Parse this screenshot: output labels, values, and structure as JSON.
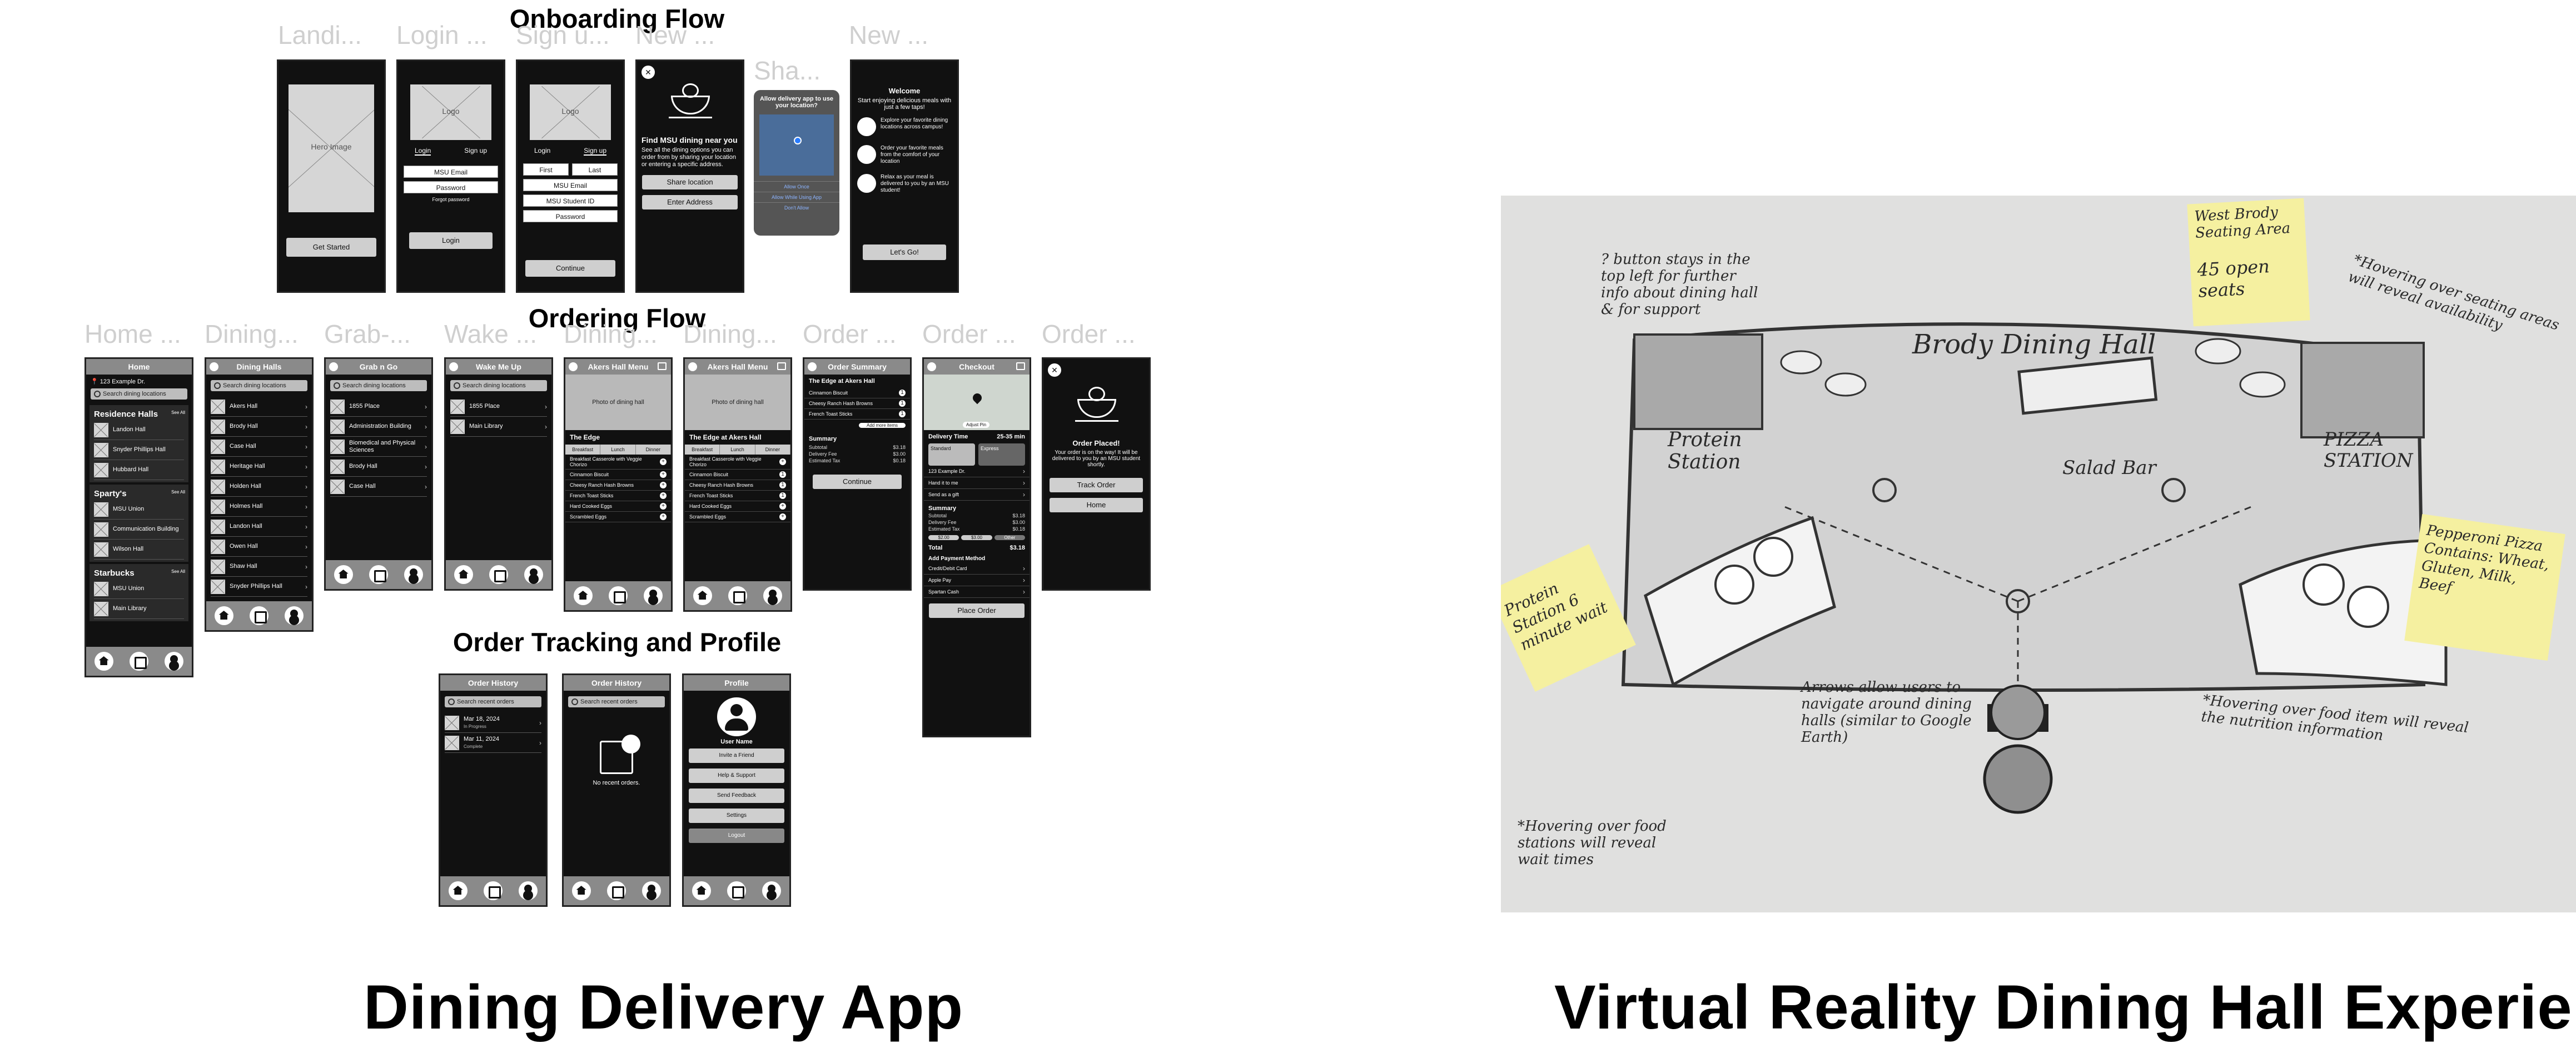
{
  "titles": {
    "left": "Dining Delivery App",
    "right": "Virtual Reality Dining Hall Experience"
  },
  "flows": {
    "onboarding": "Onboarding Flow",
    "ordering": "Ordering Flow",
    "tracking": "Order Tracking and Profile"
  },
  "onboarding_screens": [
    "Landi...",
    "Login ...",
    "Sign u...",
    "New ...",
    "Sha...",
    "New ..."
  ],
  "ordering_screens": [
    "Home ...",
    "Dining...",
    "Grab-...",
    "Wake ...",
    "Dining...",
    "Dining...",
    "Order ...",
    "Order ...",
    "Order ..."
  ],
  "landing": {
    "hero": "Hero Image",
    "button": "Get Started"
  },
  "login": {
    "logo": "Logo",
    "tab_login": "Login",
    "tab_signup": "Sign up",
    "email": "MSU Email",
    "password": "Password",
    "forgot": "Forgot password",
    "button": "Login"
  },
  "signup": {
    "logo": "Logo",
    "tab_login": "Login",
    "tab_signup": "Sign up",
    "first": "First",
    "last": "Last",
    "email": "MSU Email",
    "student_id": "MSU Student ID",
    "password": "Password",
    "button": "Continue"
  },
  "location": {
    "heading": "Find MSU dining near you",
    "body": "See all the dining options you can order from by sharing your location or entering a specific address.",
    "share": "Share location",
    "enter": "Enter Address"
  },
  "share_dialog": {
    "heading": "Allow delivery app to use your location?",
    "allow_once": "Allow Once",
    "allow_while": "Allow While Using App",
    "dont_allow": "Don't Allow"
  },
  "welcome": {
    "title": "Welcome",
    "subtitle": "Start enjoying delicious meals with just a few taps!",
    "feat1": "Explore your favorite dining locations across campus!",
    "feat2": "Order your favorite meals from the comfort of your location",
    "feat3": "Relax as your meal is delivered to you by an MSU student!",
    "button": "Let's Go!"
  },
  "home": {
    "title": "Home",
    "address": "123 Example Dr.",
    "search": "Search dining locations",
    "groups": [
      {
        "label": "Residence Halls",
        "see_all": "See All",
        "items": [
          "Landon Hall",
          "Snyder Phillips Hall",
          "Hubbard Hall"
        ]
      },
      {
        "label": "Sparty's",
        "see_all": "See All",
        "items": [
          "MSU Union",
          "Communication Building",
          "Wilson Hall"
        ]
      },
      {
        "label": "Starbucks",
        "see_all": "See All",
        "items": [
          "MSU Union",
          "Main Library"
        ]
      }
    ]
  },
  "dining_halls": {
    "title": "Dining Halls",
    "search": "Search dining locations",
    "items": [
      "Akers Hall",
      "Brody Hall",
      "Case Hall",
      "Heritage Hall",
      "Holden Hall",
      "Holmes Hall",
      "Landon Hall",
      "Owen Hall",
      "Shaw Hall",
      "Snyder Phillips Hall"
    ]
  },
  "grab_n_go": {
    "title": "Grab n Go",
    "search": "Search dining locations",
    "items": [
      "1855 Place",
      "Administration Building",
      "Biomedical and Physical Sciences",
      "Brody Hall",
      "Case Hall"
    ]
  },
  "wake_me_up": {
    "title": "Wake Me Up",
    "search": "Search dining locations",
    "items": [
      "1855 Place",
      "Main Library"
    ]
  },
  "menu": {
    "title": "Akers Hall Menu",
    "photo": "Photo of dining hall",
    "venue": "The Edge",
    "tabs": [
      "Breakfast",
      "Lunch",
      "Dinner"
    ],
    "items": [
      "Breakfast Casserole with Veggie Chorizo",
      "Cinnamon Biscuit",
      "Cheesy Ranch Hash Browns",
      "French Toast Sticks",
      "Hard Cooked Eggs",
      "Scrambled Eggs"
    ]
  },
  "menu2": {
    "title": "Akers Hall Menu",
    "photo": "Photo of dining hall",
    "venue": "The Edge at Akers Hall"
  },
  "order_summary": {
    "title": "Order Summary",
    "venue": "The Edge at Akers Hall",
    "items": [
      "Cinnamon Biscuit",
      "Cheesy Ranch Hash Browns",
      "French Toast Sticks"
    ],
    "add_more": "Add more items",
    "summary": "Summary",
    "subtotal_label": "Subtotal",
    "subtotal": "$3.18",
    "delivery_label": "Delivery Fee",
    "delivery": "$3.00",
    "tax_label": "Estimated Tax",
    "tax": "$0.18",
    "button": "Continue"
  },
  "checkout": {
    "title": "Checkout",
    "adjust": "Adjust Pin",
    "delivery_time": "Delivery Time",
    "eta": "25-35 min",
    "standard": "Standard",
    "express": "Express",
    "address": "123 Example Dr.",
    "hand": "Hand it to me",
    "gift": "Send as a gift",
    "summary": "Summary",
    "tips": [
      "$2.00",
      "$3.00",
      "Other"
    ],
    "total_label": "Total",
    "total": "$3.18",
    "payment": "Add Payment Method",
    "methods": [
      "Credit/Debit Card",
      "Apple Pay",
      "Spartan Cash"
    ],
    "button": "Place Order"
  },
  "placed": {
    "title": "Order Placed!",
    "body": "Your order is on the way! It will be delivered to you by an MSU student shortly.",
    "track": "Track Order",
    "home": "Home"
  },
  "history": {
    "title": "Order History",
    "search": "Search recent orders",
    "orders": [
      {
        "date": "Mar 18, 2024",
        "status": "In Progress"
      },
      {
        "date": "Mar 11, 2024",
        "status": "Complete"
      }
    ]
  },
  "history_empty": {
    "title": "Order History",
    "search": "Search recent orders",
    "empty": "No recent orders."
  },
  "profile": {
    "title": "Profile",
    "username": "User Name",
    "items": [
      "Invite a Friend",
      "Help & Support",
      "Send Feedback",
      "Settings",
      "Logout"
    ]
  },
  "vr": {
    "hall": "Brody Dining Hall",
    "salad": "Salad Bar",
    "protein": "Protein Station",
    "pizza": "PIZZA STATION",
    "note_top_left": "? button stays in the top left for further info about dining hall & for support",
    "seating_title": "West Brody Seating Area",
    "seats": "45 open seats",
    "note_seating": "*Hovering over seating areas will reveal availability",
    "pizza_note": "Pepperoni Pizza Contains: Wheat, Gluten, Milk, Beef",
    "protein_note": "Protein Station 6 minute wait",
    "note_arrows": "Arrows allow users to navigate around dining halls (similar to Google Earth)",
    "note_food": "*Hovering over food item will reveal the nutrition information",
    "note_stations": "*Hovering over food stations will reveal wait times"
  }
}
